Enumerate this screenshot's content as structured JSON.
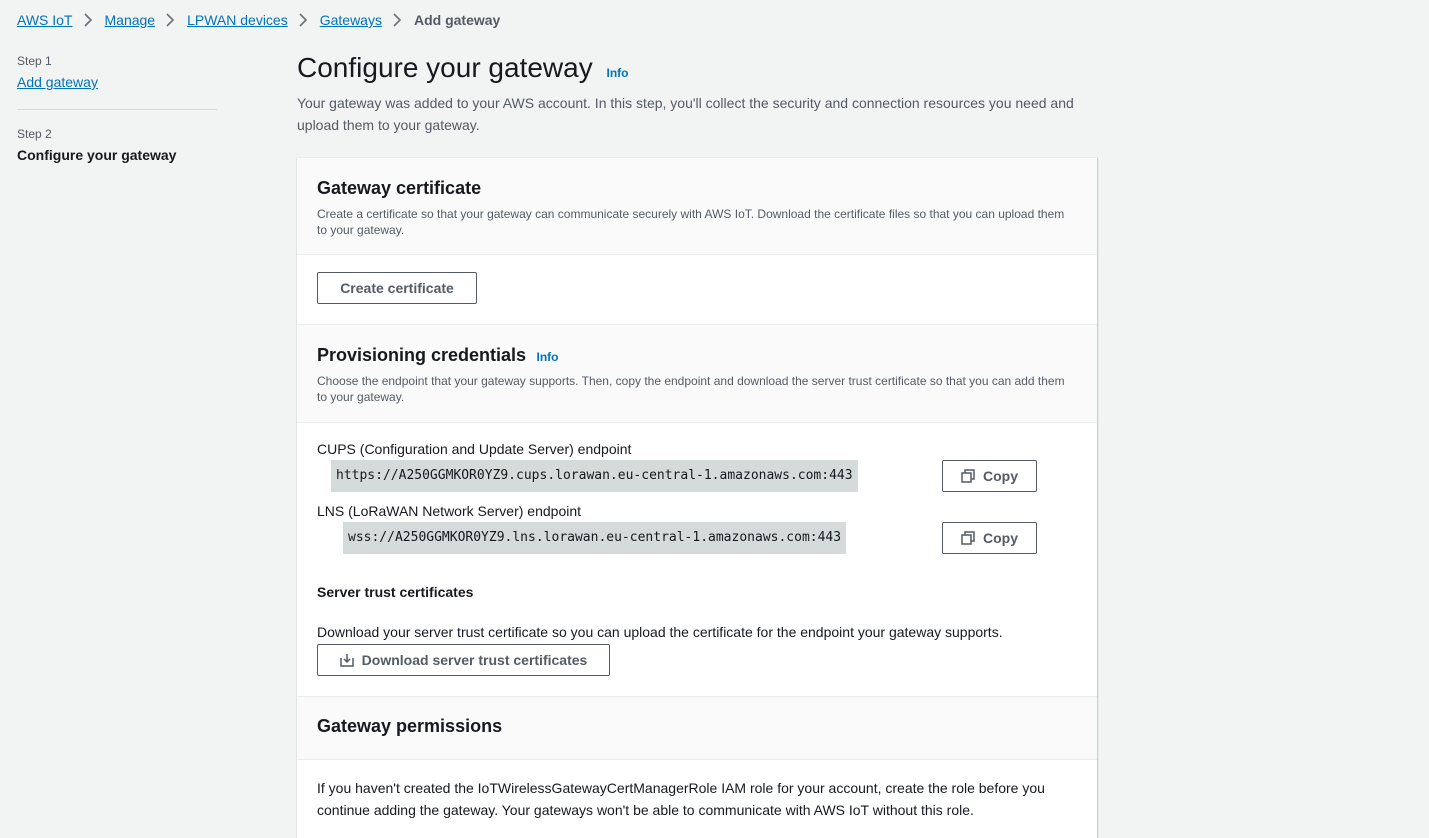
{
  "breadcrumb": {
    "items": [
      "AWS IoT",
      "Manage",
      "LPWAN devices",
      "Gateways"
    ],
    "current": "Add gateway"
  },
  "steps": {
    "step1_label": "Step 1",
    "step1_link": "Add gateway",
    "step2_label": "Step 2",
    "step2_title": "Configure your gateway"
  },
  "header": {
    "title": "Configure your gateway",
    "info": "Info",
    "description": "Your gateway was added to your AWS account. In this step, you'll collect the security and connection resources you need and upload them to your gateway."
  },
  "certificate": {
    "title": "Gateway certificate",
    "description": "Create a certificate so that your gateway can communicate securely with AWS IoT. Download the certificate files so that you can upload them to your gateway.",
    "create_button": "Create certificate"
  },
  "provisioning": {
    "title": "Provisioning credentials",
    "info": "Info",
    "description": "Choose the endpoint that your gateway supports. Then, copy the endpoint and download the server trust certificate so that you can add them to your gateway.",
    "cups_label": "CUPS (Configuration and Update Server) endpoint",
    "cups_value": "https://A250GGMKOR0YZ9.cups.lorawan.eu-central-1.amazonaws.com:443",
    "lns_label": "LNS (LoRaWAN Network Server) endpoint",
    "lns_value": "wss://A250GGMKOR0YZ9.lns.lorawan.eu-central-1.amazonaws.com:443",
    "copy_label": "Copy",
    "trust_title": "Server trust certificates",
    "trust_desc": "Download your server trust certificate so you can upload the certificate for the endpoint your gateway supports.",
    "download_button": "Download server trust certificates"
  },
  "permissions": {
    "title": "Gateway permissions",
    "description": "If you haven't created the IoTWirelessGatewayCertManagerRole IAM role for your account, create the role before you continue adding the gateway. Your gateways won't be able to communicate with AWS IoT without this role."
  },
  "icons": {
    "separator": "chevron-right-icon",
    "copy": "copy-icon",
    "download": "download-icon"
  },
  "colors": {
    "link": "#0073bb",
    "background": "#f2f3f3",
    "code_background": "#d5dbdb"
  }
}
